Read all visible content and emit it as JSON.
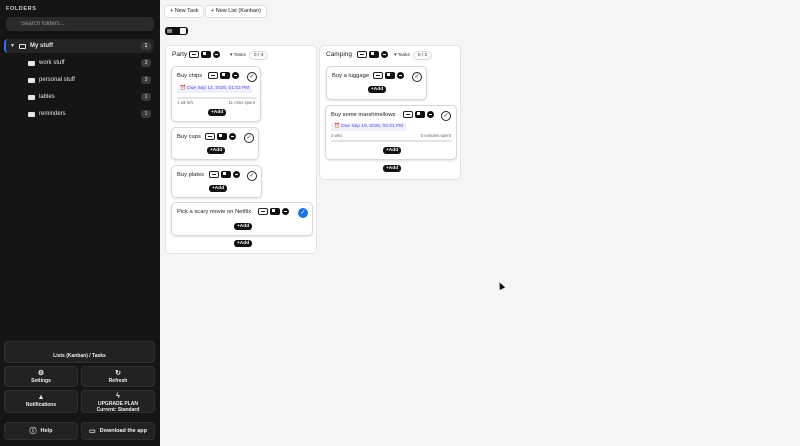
{
  "sidebar": {
    "heading": "FOLDERS",
    "search_placeholder": "Search folders...",
    "root_folder": {
      "label": "My stuff",
      "count": "1"
    },
    "folders": [
      {
        "label": "work stuff",
        "count": "3"
      },
      {
        "label": "personal stuff",
        "count": "3"
      },
      {
        "label": "lables",
        "count": "1"
      },
      {
        "label": "reminders",
        "count": "1"
      }
    ],
    "buttons": {
      "lists": "Lists (Kanban) / Tasks",
      "settings": "Settings",
      "refresh": "Refresh",
      "notifications": "Notifications",
      "upgrade_line1": "UPGRADE PLAN",
      "upgrade_line2": "Current: Standard",
      "help": "Help",
      "download": "Download the app"
    }
  },
  "toolbar": {
    "new_task": "+ New Task",
    "new_list": "+ New List (Kanban)"
  },
  "lists": [
    {
      "title": "Party",
      "tasks_label": "▾ Tasks",
      "tasks_count": "0 / 4",
      "cards": [
        {
          "title": "Buy chips",
          "due": "⏰ Due Sep 12, 2026, 01:03 PM",
          "left_meta": "1 wk left",
          "right_meta": "11 mins spent",
          "progress": 0
        },
        {
          "title": "Buy cups"
        },
        {
          "title": "Buy plates"
        },
        {
          "title": "Pick a scary movie on Netflix",
          "done": true
        }
      ],
      "add_label": "+Add"
    },
    {
      "title": "Camping",
      "tasks_label": "▾ Tasks",
      "tasks_count": "0 / 2",
      "cards": [
        {
          "title": "Buy a luggage"
        },
        {
          "title": "Buy some marshmellows",
          "due": "⏰ Due Sep 19, 2026, 02:21 PM",
          "left_meta": "2 wks",
          "right_meta": "0 minutes spent",
          "progress": 0
        }
      ],
      "add_label": "+Add"
    }
  ],
  "card_add_label": "+Add",
  "check_glyph": "✓",
  "colors": {
    "accent": "#1f6fe5",
    "sidebar_bg": "#151515"
  }
}
